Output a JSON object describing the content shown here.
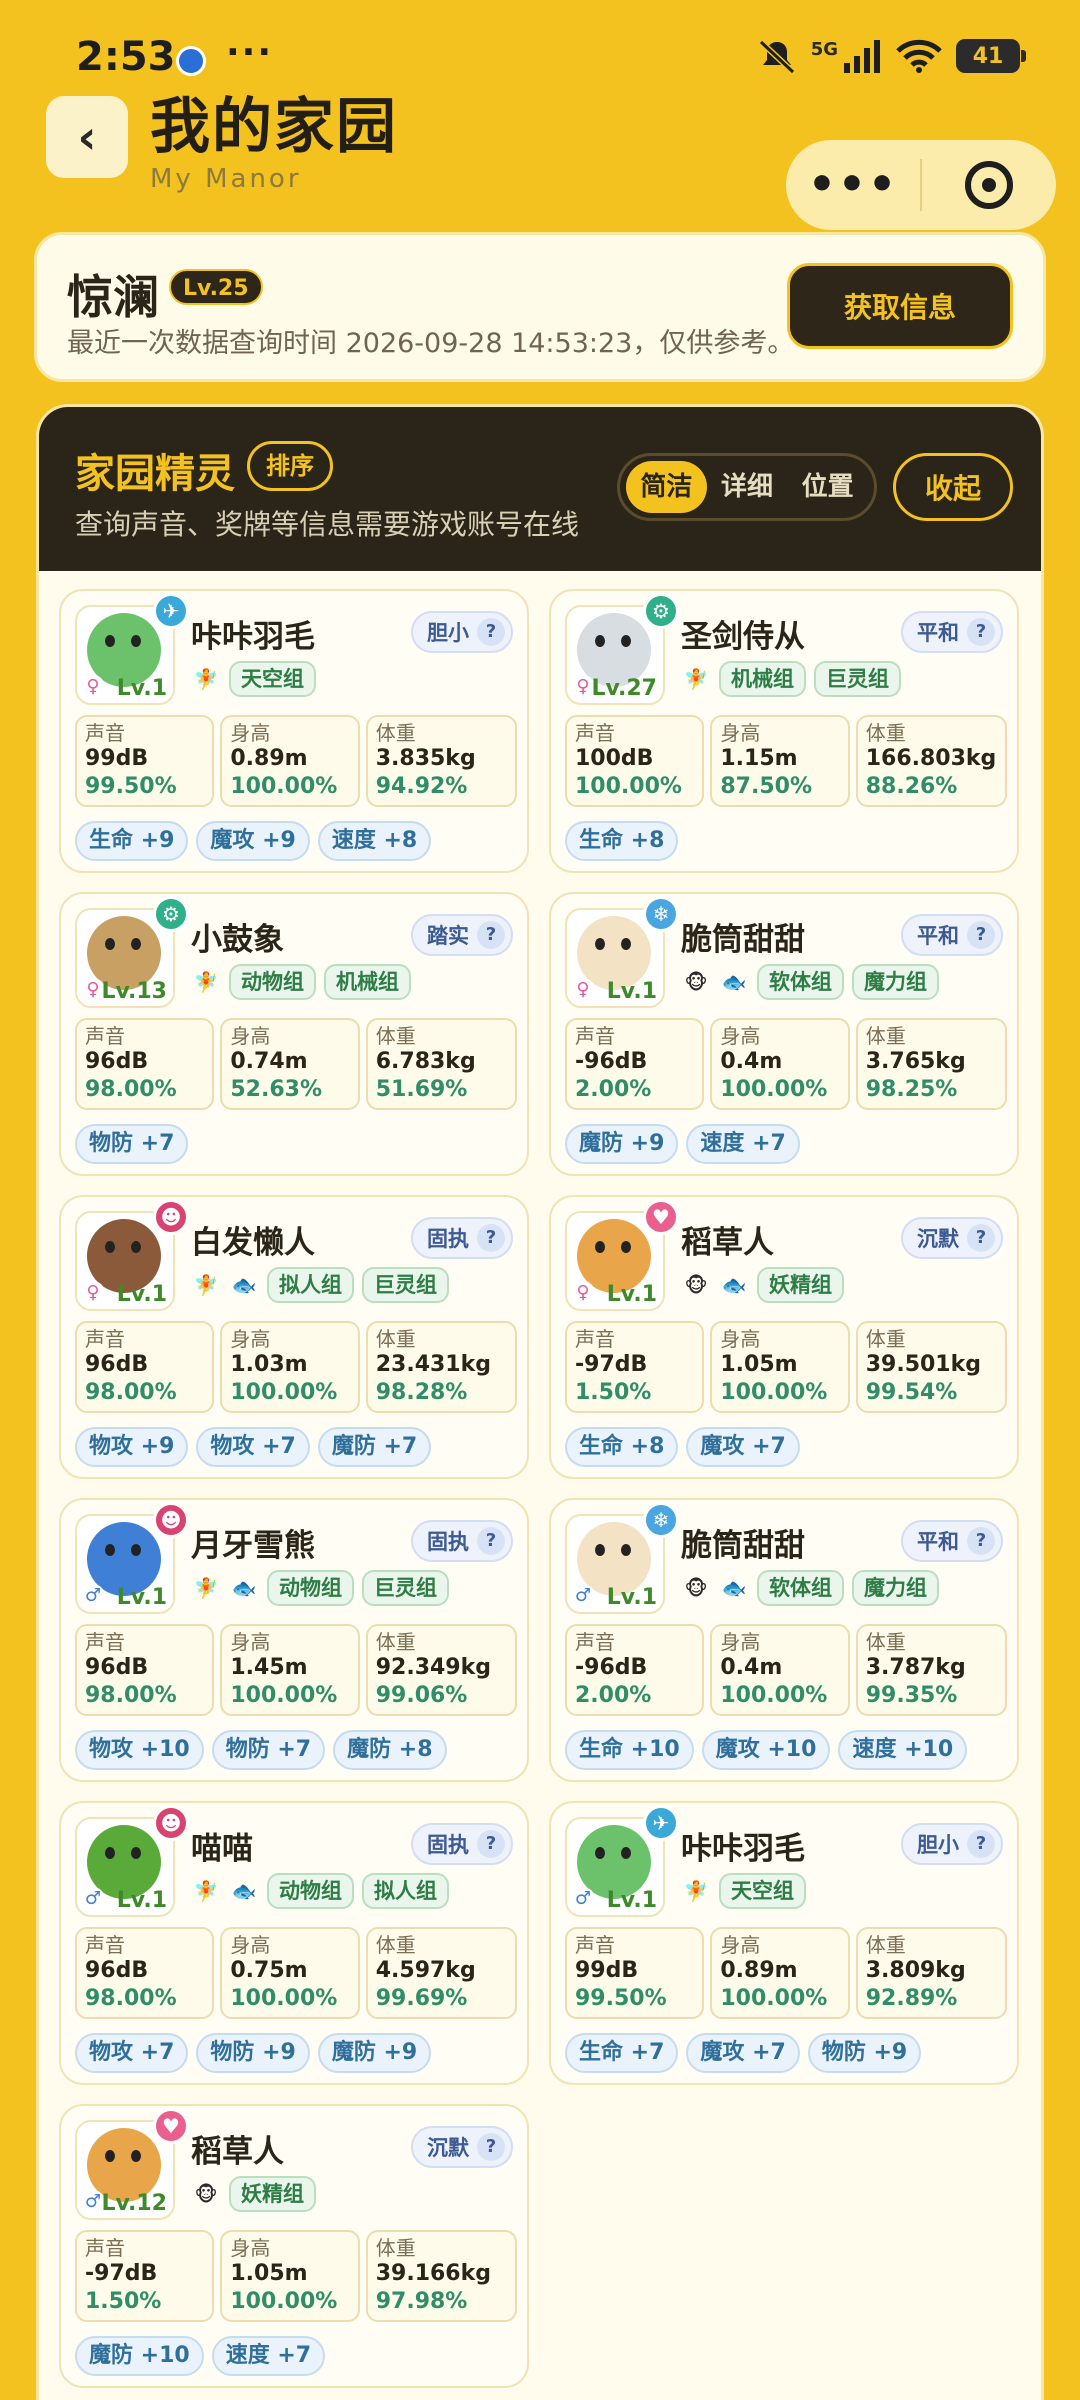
{
  "status_bar": {
    "time": "2:53",
    "dots": "···",
    "network": "5G",
    "battery": "41",
    "icons": [
      "mute-icon",
      "signal-icon",
      "wifi-icon",
      "battery-icon"
    ]
  },
  "header": {
    "back_glyph": "‹",
    "title": "我的家园",
    "subtitle": "My Manor",
    "more_glyph": "•••"
  },
  "user": {
    "name": "惊澜",
    "level": "Lv.25",
    "last_query": "最近一次数据查询时间 2026-09-28 14:53:23，仅供参考。",
    "fetch_label": "获取信息"
  },
  "panel": {
    "title": "家园精灵",
    "sort_label": "排序",
    "note": "查询声音、奖牌等信息需要游戏账号在线",
    "view_options": [
      "简洁",
      "详细",
      "位置"
    ],
    "active_view": "简洁",
    "collapse_label": "收起"
  },
  "stat_labels": {
    "sound": "声音",
    "height": "身高",
    "weight": "体重"
  },
  "help_glyph": "?",
  "cards": [
    {
      "name": "咔咔羽毛",
      "nature": "胆小",
      "level": "Lv.1",
      "gender": "♀",
      "element_color": "#3aa8d8",
      "element_glyph": "✈",
      "avatar_color": "#6cc26a",
      "tag_icons": [
        "🧚"
      ],
      "groups": [
        "天空组"
      ],
      "sound": "99dB",
      "sound_pct": "99.50%",
      "height": "0.89m",
      "height_pct": "100.00%",
      "weight": "3.835kg",
      "weight_pct": "94.92%",
      "boosts": [
        "生命 +9",
        "魔攻 +9",
        "速度 +8"
      ]
    },
    {
      "name": "圣剑侍从",
      "nature": "平和",
      "level": "Lv.27",
      "gender": "♀",
      "element_color": "#2fb08a",
      "element_glyph": "⚙",
      "avatar_color": "#d8dde2",
      "tag_icons": [
        "🧚"
      ],
      "groups": [
        "机械组",
        "巨灵组"
      ],
      "sound": "100dB",
      "sound_pct": "100.00%",
      "height": "1.15m",
      "height_pct": "87.50%",
      "weight": "166.803kg",
      "weight_pct": "88.26%",
      "boosts": [
        "生命 +8"
      ]
    },
    {
      "name": "小鼓象",
      "nature": "踏实",
      "level": "Lv.13",
      "gender": "♀",
      "element_color": "#2fb08a",
      "element_glyph": "⚙",
      "avatar_color": "#c9a064",
      "tag_icons": [
        "🧚"
      ],
      "groups": [
        "动物组",
        "机械组"
      ],
      "sound": "96dB",
      "sound_pct": "98.00%",
      "height": "0.74m",
      "height_pct": "52.63%",
      "weight": "6.783kg",
      "weight_pct": "51.69%",
      "boosts": [
        "物防 +7"
      ]
    },
    {
      "name": "脆筒甜甜",
      "nature": "平和",
      "level": "Lv.1",
      "gender": "♀",
      "element_color": "#4aa6e0",
      "element_glyph": "❄",
      "avatar_color": "#f3e2c4",
      "tag_icons": [
        "🐵",
        "🐟"
      ],
      "groups": [
        "软体组",
        "魔力组"
      ],
      "sound": "-96dB",
      "sound_pct": "2.00%",
      "height": "0.4m",
      "height_pct": "100.00%",
      "weight": "3.765kg",
      "weight_pct": "98.25%",
      "boosts": [
        "魔防 +9",
        "速度 +7"
      ]
    },
    {
      "name": "白发懒人",
      "nature": "固执",
      "level": "Lv.1",
      "gender": "♀",
      "element_color": "#d9436f",
      "element_glyph": "☻",
      "avatar_color": "#8a5a3a",
      "tag_icons": [
        "🧚",
        "🐟"
      ],
      "groups": [
        "拟人组",
        "巨灵组"
      ],
      "sound": "96dB",
      "sound_pct": "98.00%",
      "height": "1.03m",
      "height_pct": "100.00%",
      "weight": "23.431kg",
      "weight_pct": "98.28%",
      "boosts": [
        "物攻 +9",
        "物攻 +7",
        "魔防 +7"
      ]
    },
    {
      "name": "稻草人",
      "nature": "沉默",
      "level": "Lv.1",
      "gender": "♀",
      "element_color": "#ea5f8e",
      "element_glyph": "♥",
      "avatar_color": "#e9a54a",
      "tag_icons": [
        "🐵",
        "🐟"
      ],
      "groups": [
        "妖精组"
      ],
      "sound": "-97dB",
      "sound_pct": "1.50%",
      "height": "1.05m",
      "height_pct": "100.00%",
      "weight": "39.501kg",
      "weight_pct": "99.54%",
      "boosts": [
        "生命 +8",
        "魔攻 +7"
      ]
    },
    {
      "name": "月牙雪熊",
      "nature": "固执",
      "level": "Lv.1",
      "gender": "♂",
      "element_color": "#d9436f",
      "element_glyph": "☻",
      "avatar_color": "#3f7fd6",
      "tag_icons": [
        "🧚",
        "🐟"
      ],
      "groups": [
        "动物组",
        "巨灵组"
      ],
      "sound": "96dB",
      "sound_pct": "98.00%",
      "height": "1.45m",
      "height_pct": "100.00%",
      "weight": "92.349kg",
      "weight_pct": "99.06%",
      "boosts": [
        "物攻 +10",
        "物防 +7",
        "魔防 +8"
      ]
    },
    {
      "name": "脆筒甜甜",
      "nature": "平和",
      "level": "Lv.1",
      "gender": "♂",
      "element_color": "#4aa6e0",
      "element_glyph": "❄",
      "avatar_color": "#f3e2c4",
      "tag_icons": [
        "🐵",
        "🐟"
      ],
      "groups": [
        "软体组",
        "魔力组"
      ],
      "sound": "-96dB",
      "sound_pct": "2.00%",
      "height": "0.4m",
      "height_pct": "100.00%",
      "weight": "3.787kg",
      "weight_pct": "99.35%",
      "boosts": [
        "生命 +10",
        "魔攻 +10",
        "速度 +10"
      ]
    },
    {
      "name": "喵喵",
      "nature": "固执",
      "level": "Lv.1",
      "gender": "♂",
      "element_color": "#d9436f",
      "element_glyph": "☻",
      "avatar_color": "#5aaa3a",
      "tag_icons": [
        "🧚",
        "🐟"
      ],
      "groups": [
        "动物组",
        "拟人组"
      ],
      "sound": "96dB",
      "sound_pct": "98.00%",
      "height": "0.75m",
      "height_pct": "100.00%",
      "weight": "4.597kg",
      "weight_pct": "99.69%",
      "boosts": [
        "物攻 +7",
        "物防 +9",
        "魔防 +9"
      ]
    },
    {
      "name": "咔咔羽毛",
      "nature": "胆小",
      "level": "Lv.1",
      "gender": "♂",
      "element_color": "#3aa8d8",
      "element_glyph": "✈",
      "avatar_color": "#6cc26a",
      "tag_icons": [
        "🧚"
      ],
      "groups": [
        "天空组"
      ],
      "sound": "99dB",
      "sound_pct": "99.50%",
      "height": "0.89m",
      "height_pct": "100.00%",
      "weight": "3.809kg",
      "weight_pct": "92.89%",
      "boosts": [
        "生命 +7",
        "魔攻 +7",
        "物防 +9"
      ]
    },
    {
      "name": "稻草人",
      "nature": "沉默",
      "level": "Lv.12",
      "gender": "♂",
      "element_color": "#ea5f8e",
      "element_glyph": "♥",
      "avatar_color": "#e9a54a",
      "tag_icons": [
        "🐵"
      ],
      "groups": [
        "妖精组"
      ],
      "sound": "-97dB",
      "sound_pct": "1.50%",
      "height": "1.05m",
      "height_pct": "100.00%",
      "weight": "39.166kg",
      "weight_pct": "97.98%",
      "boosts": [
        "魔防 +10",
        "速度 +7"
      ]
    }
  ]
}
